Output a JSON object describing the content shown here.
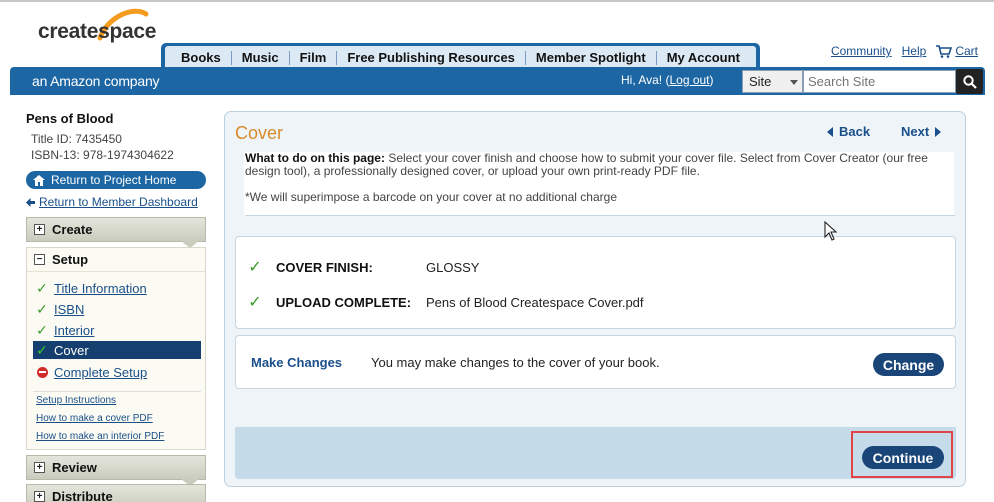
{
  "brand": {
    "logo_text": "createspace",
    "tagline": "an Amazon company"
  },
  "nav": {
    "tabs": [
      "Books",
      "Music",
      "Film",
      "Free Publishing Resources",
      "Member Spotlight",
      "My Account"
    ]
  },
  "util": {
    "community": "Community",
    "help": "Help",
    "cart": "Cart"
  },
  "user": {
    "greeting": "Hi, Ava! (",
    "logout": "Log out",
    "greeting_end": ")"
  },
  "search": {
    "scope": "Site",
    "placeholder": "Search Site"
  },
  "project": {
    "title": "Pens of Blood",
    "title_id": "Title ID: 7435450",
    "isbn": "ISBN-13: 978-1974304622",
    "home_button": "Return to Project Home",
    "dashboard_link": "Return to Member Dashboard"
  },
  "sidebar": {
    "create": "Create",
    "setup": "Setup",
    "steps": [
      {
        "label": "Title Information"
      },
      {
        "label": "ISBN"
      },
      {
        "label": "Interior"
      },
      {
        "label": "Cover"
      },
      {
        "label": "Complete Setup"
      }
    ],
    "help_links": [
      "Setup Instructions",
      "How to make a cover PDF",
      "How to make an interior PDF"
    ],
    "review": "Review",
    "distribute": "Distribute"
  },
  "main": {
    "title": "Cover",
    "back": "Back",
    "next": "Next",
    "instr_label": "What to do on this page:",
    "instr_text": "Select your cover finish and choose how to submit your cover file. Select from Cover Creator (our free design tool), a professionally designed cover, or upload your own print-ready PDF file.",
    "barcode_note": "*We will superimpose a barcode on your cover at no additional charge",
    "status": [
      {
        "label": "COVER FINISH:",
        "value": "GLOSSY"
      },
      {
        "label": "UPLOAD COMPLETE:",
        "value": "Pens of Blood Createspace Cover.pdf"
      }
    ],
    "changes_title": "Make Changes",
    "changes_text": "You may make changes to the cover of your book.",
    "change_button": "Change",
    "continue_button": "Continue"
  },
  "colors": {
    "brand_blue": "#1d66a4",
    "accent_orange": "#d88a2c",
    "button_navy": "#1a4578",
    "highlight_red": "#e04444"
  }
}
